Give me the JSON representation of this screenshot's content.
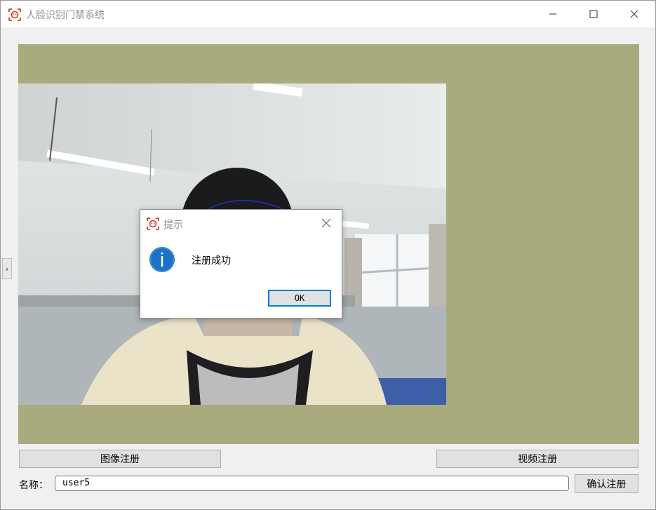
{
  "window": {
    "title": "人脸识别门禁系统",
    "icon": "face-scan-icon",
    "controls": [
      "minimize-icon",
      "maximize-icon",
      "close-icon"
    ]
  },
  "buttons": {
    "image_register": "图像注册",
    "video_register": "视频注册",
    "confirm_register": "确认注册"
  },
  "name_field": {
    "label": "名称：",
    "value": "user5"
  },
  "dialog": {
    "title": "提示",
    "message": "注册成功",
    "ok_label": "OK",
    "icon": "info-icon"
  },
  "colors": {
    "video_background": "#a9aa7e",
    "accent": "#0078d7",
    "app_icon": "#d23a2a"
  }
}
